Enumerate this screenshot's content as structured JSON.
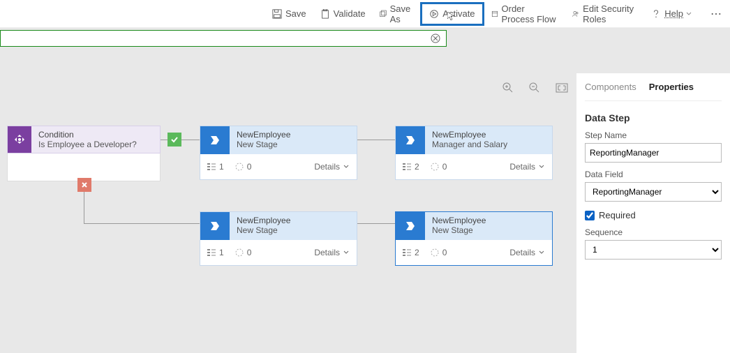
{
  "toolbar": {
    "save": "Save",
    "validate": "Validate",
    "saveas": "Save As",
    "activate": "Activate",
    "order": "Order Process Flow",
    "roles": "Edit Security Roles",
    "help": "Help"
  },
  "condition": {
    "title": "Condition",
    "sub": "Is Employee a Developer?"
  },
  "stages": {
    "s1": {
      "title": "NewEmployee",
      "sub": "New Stage",
      "steps": "1",
      "dur": "0",
      "btn": "Details"
    },
    "s2": {
      "title": "NewEmployee",
      "sub": "Manager and Salary",
      "steps": "2",
      "dur": "0",
      "btn": "Details"
    },
    "s3": {
      "title": "NewEmployee",
      "sub": "New Stage",
      "steps": "1",
      "dur": "0",
      "btn": "Details"
    },
    "s4": {
      "title": "NewEmployee",
      "sub": "New Stage",
      "steps": "2",
      "dur": "0",
      "btn": "Details"
    }
  },
  "side": {
    "tab1": "Components",
    "tab2": "Properties",
    "section": "Data Step",
    "l_name": "Step Name",
    "v_name": "ReportingManager",
    "l_field": "Data Field",
    "v_field": "ReportingManager",
    "l_req": "Required",
    "l_seq": "Sequence",
    "v_seq": "1"
  }
}
